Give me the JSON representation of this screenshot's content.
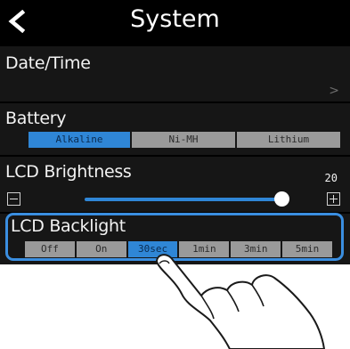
{
  "header": {
    "title": "System"
  },
  "menu": {
    "date_time": {
      "label": "Date/Time",
      "chevron": ">"
    },
    "battery": {
      "label": "Battery",
      "options": [
        "Alkaline",
        "Ni-MH",
        "Lithium"
      ],
      "selected": "Alkaline"
    },
    "lcd_brightness": {
      "label": "LCD Brightness",
      "value": "20",
      "level": 0.95
    },
    "lcd_backlight": {
      "label": "LCD Backlight",
      "options": [
        "Off",
        "On",
        "30sec",
        "1min",
        "3min",
        "5min"
      ],
      "selected": "30sec"
    }
  },
  "colors": {
    "accent": "#2f86d6",
    "background": "#000000",
    "highlight_frame": "#3a8ee0"
  },
  "icons": {
    "back": "chevron-left-icon",
    "minus": "minus-icon",
    "plus": "plus-icon",
    "pointer": "hand-pointer-icon"
  }
}
